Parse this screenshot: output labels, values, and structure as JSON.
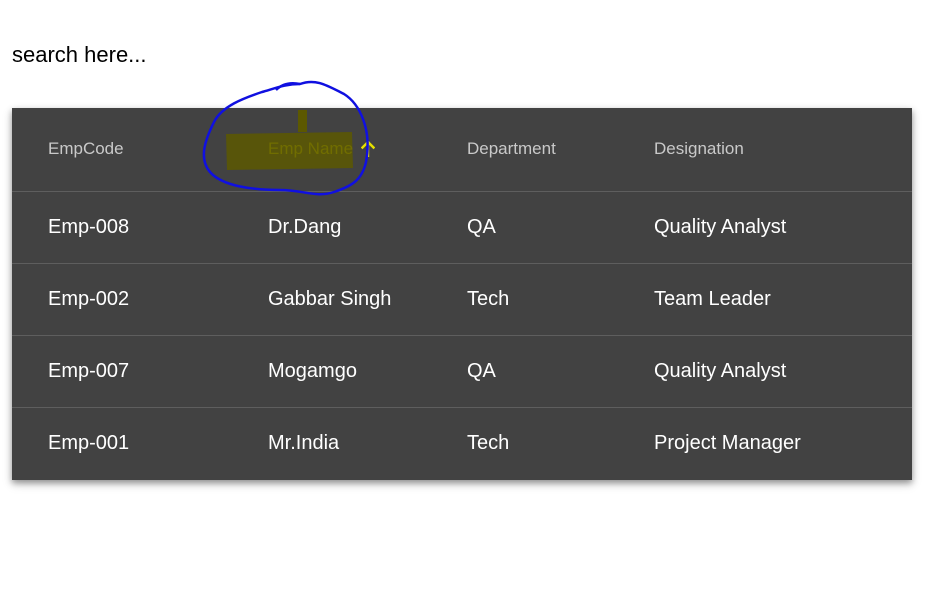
{
  "search": {
    "placeholder": "search here..."
  },
  "table": {
    "headers": {
      "emp_code": "EmpCode",
      "emp_name": "Emp Name",
      "department": "Department",
      "designation": "Designation"
    },
    "sort": {
      "column": "Emp Name",
      "direction": "ascending",
      "icon": "arrow-up-icon"
    },
    "rows": [
      {
        "emp_code": "Emp-008",
        "emp_name": "Dr.Dang",
        "department": "QA",
        "designation": "Quality Analyst"
      },
      {
        "emp_code": "Emp-002",
        "emp_name": "Gabbar Singh",
        "department": "Tech",
        "designation": "Team Leader"
      },
      {
        "emp_code": "Emp-007",
        "emp_name": "Mogamgo",
        "department": "QA",
        "designation": "Quality Analyst"
      },
      {
        "emp_code": "Emp-001",
        "emp_name": "Mr.India",
        "department": "Tech",
        "designation": "Project Manager"
      }
    ]
  },
  "colors": {
    "table_background": "#424242",
    "header_text": "#c9c9c9",
    "sorted_header_text": "#e5e000",
    "highlight": "#5c5800",
    "annotation_circle": "#1010e0"
  }
}
